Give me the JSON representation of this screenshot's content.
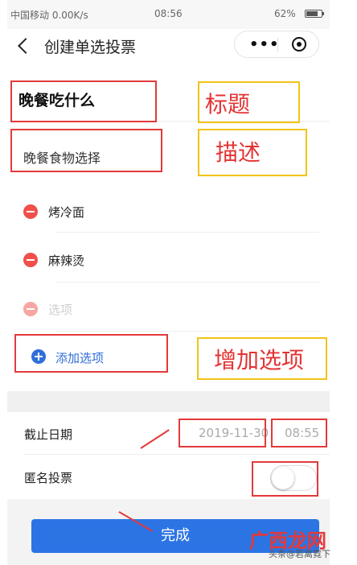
{
  "status_bar": {
    "left": "中国移动 0.00K/s",
    "time": "08:56",
    "battery": "62%"
  },
  "nav": {
    "title": "创建单选投票",
    "more_label": "•••"
  },
  "form": {
    "title_value": "晚餐吃什么",
    "description_value": "晚餐食物选择",
    "options": [
      {
        "text": "烤冷面"
      },
      {
        "text": "麻辣烫"
      }
    ],
    "option_placeholder": "选项",
    "add_option_label": "添加选项"
  },
  "settings": {
    "deadline_label": "截止日期",
    "deadline_date": "2019-11-30",
    "deadline_time": "08:55",
    "anonymous_label": "匿名投票",
    "anonymous_on": false
  },
  "done_label": "完成",
  "annotations": {
    "title_note": "标题",
    "description_note": "描述",
    "add_option_note": "增加选项"
  },
  "watermark": {
    "logo": "广西龙网",
    "caption": "头条@若离霓下"
  },
  "colors": {
    "primary_blue": "#2c74e4",
    "delete_red": "#f0504a",
    "annotation_red": "#e23a3a",
    "annotation_yellow": "#f0c419"
  }
}
